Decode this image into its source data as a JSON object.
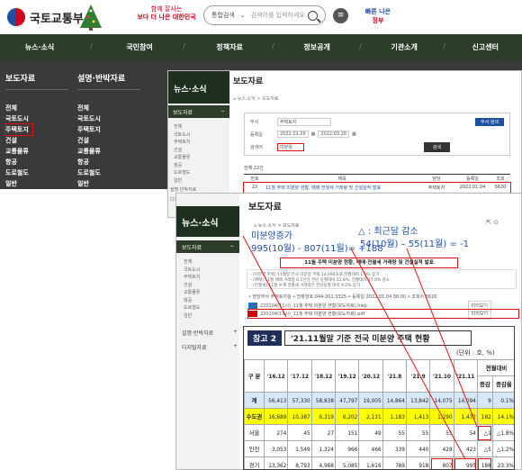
{
  "site": {
    "logo": "국토교통부",
    "slogan_l1": "함께 잘사는",
    "slogan_l2": "보다 더 나은 대한민국",
    "search_scope": "통합검색",
    "search_placeholder": "검색어를 입력하세요.",
    "menu_icon": "≡",
    "bunny_l1": "빠른 나은",
    "bunny_l2": "정부"
  },
  "gnb": [
    "뉴스·소식",
    "국민참여",
    "정책자료",
    "정보공개",
    "기관소개",
    "신고센터"
  ],
  "dropdown": {
    "col1": {
      "title": "보도자료",
      "items": [
        "전체",
        "국토도시",
        "주택토지",
        "건설",
        "교통물류",
        "항공",
        "도로철도",
        "일반"
      ]
    },
    "col2": {
      "title": "설명·반박자료",
      "items": [
        "전체",
        "국토도시",
        "주택토지",
        "건설",
        "교통물류",
        "항공",
        "도로철도",
        "일반"
      ]
    }
  },
  "win2": {
    "side_title": "뉴스·소식",
    "side_selected": "보도자료",
    "side_collapse": "−",
    "side_items": [
      "전체",
      "국토도시",
      "주택토지",
      "건설",
      "교통물류",
      "항공",
      "도로철도",
      "일반"
    ],
    "side_more": "설명·반박자료",
    "side_more2": "디지털자료",
    "title": "보도자료",
    "breadcrumb": "⌂ 뉴스·소식 > 보도자료",
    "f_section": "부서",
    "f_section_val": "주택토지",
    "f_period": "등록일",
    "f_from": "2022.01.26",
    "f_to": "2022.03.28",
    "f_keyword": "검색어",
    "f_keyword_val": "미분양",
    "btn_dept": "부서 검색",
    "btn_search": "검색",
    "count": "전체 22건",
    "cols": [
      "번호",
      "제목",
      "담당",
      "등록일",
      "조회"
    ],
    "row": [
      "22",
      "11월 주택 미분양 현황, 매매·전월세 거래량 및 건설실적 발표",
      "주택토지",
      "2022.01.04",
      "5620"
    ]
  },
  "win3": {
    "side_title": "뉴스·소식",
    "side_selected": "보도자료",
    "side_collapse": "−",
    "side_items": [
      "전체",
      "국토도시",
      "주택토지",
      "건설",
      "교통물류",
      "항공",
      "도로철도",
      "일반"
    ],
    "side_more": "설명·반박자료",
    "side_more2": "디지털자료",
    "plus": "+",
    "title": "보도자료",
    "breadcrumb": "⌂ 뉴스·소식 > 보도자료",
    "notice": "11월 주택 미분양 현황, 매매·전월세 거래량 및 건설실적 발표",
    "box_l1": "- (미분양 주택) 11월말 전국 미분양 주택 14,094호로 전월대비 1.1% 증가",
    "box_l2": "- (매매) 11월 매매 거래량 8.1만건 전년 동월대비 22.8%, 전월대비 17.0% 감소",
    "box_l3": "- (전월세) 11월 누계 전월세 거래량은 전년동월 대비 9.2% 증가",
    "meta1": "• 담당부서  주택토지실  • 전화번호 044-201-3325  • 등록일 2022.01.04 06:00  • 조회수 5620",
    "file1": "220104(11시)_11월 주택 미분양 현황(보도자료).hwp",
    "file2": "220104(11시)_11월 주택 미분양 현황(보도자료).pdf",
    "preview": "미리보기",
    "ann_left1": "미분양증가",
    "ann_left2": "995(10월) - 807(11월)= +188",
    "ann_right1": "△ : 최근달 감소",
    "ann_right2": "54(10월) – 55(11월) = -1"
  },
  "table": {
    "badge": "참고 2",
    "caption": "'21.11월말 기준 전국 미분양 주택 현황",
    "unit": "(단위 : 호, %)",
    "header_group": "전월대비",
    "col_label": "구 분",
    "years": [
      "'16.12",
      "'17.12",
      "'18.12",
      "'19.12",
      "'20.12",
      "'21.8",
      "'21.9",
      "'21.10",
      "'21.11"
    ],
    "diff_cols": [
      "증감",
      "증감율"
    ],
    "rows": [
      {
        "label": "계",
        "vals": [
          "56,413",
          "57,330",
          "58,838",
          "47,797",
          "19,005",
          "14,864",
          "13,842",
          "14,075",
          "14,094"
        ],
        "d": "9",
        "r": "0.1%"
      },
      {
        "label": "수도권",
        "vals": [
          "16,689",
          "10,387",
          "6,319",
          "6,202",
          "2,131",
          "1,183",
          "1,413",
          "1,290",
          "1,472"
        ],
        "d": "182",
        "r": "14.1%"
      },
      {
        "label": "서울",
        "vals": [
          "274",
          "45",
          "27",
          "151",
          "49",
          "55",
          "55",
          "55",
          "54"
        ],
        "d": "△1",
        "r": "△1.8%"
      },
      {
        "label": "인천",
        "vals": [
          "3,053",
          "1,549",
          "1,324",
          "966",
          "466",
          "339",
          "440",
          "428",
          "423"
        ],
        "d": "△5",
        "r": "△1.2%"
      },
      {
        "label": "경기",
        "vals": [
          "13,362",
          "8,793",
          "4,968",
          "5,085",
          "1,616",
          "789",
          "918",
          "807",
          "995"
        ],
        "d": "188",
        "r": "23.3%"
      }
    ]
  }
}
